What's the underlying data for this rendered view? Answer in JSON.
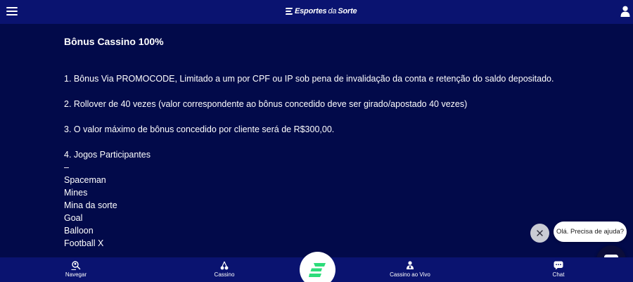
{
  "header": {
    "logo": {
      "text_main": "Esportes",
      "text_da": "da",
      "text_end": "Sorte"
    }
  },
  "content": {
    "title": "Bônus Cassino 100%",
    "rules": [
      "1. Bônus Via PROMOCODE, Limitado a um por CPF ou IP sob pena de invalidação da conta e retenção do saldo depositado.",
      "2. Rollover de 40 vezes (valor correspondente ao bônus concedido deve ser girado/apostado 40 vezes)",
      "3. O valor máximo de bônus concedido por cliente será de R$300,00.",
      "4. Jogos Participantes"
    ],
    "games_separator": "–",
    "games": [
      "Spaceman",
      "Mines",
      "Mina da sorte",
      "Goal",
      "Balloon",
      "Football X"
    ]
  },
  "chat_widget": {
    "bubble_text": "Olá. Precisa de ajuda?"
  },
  "bottom_nav": {
    "items": [
      {
        "label": "Navegar",
        "icon": "search-people-icon"
      },
      {
        "label": "Cassino",
        "icon": "cherries-icon"
      },
      {
        "label": "Cassino ao Vivo",
        "icon": "dealer-icon"
      },
      {
        "label": "Chat",
        "icon": "chat-icon"
      }
    ],
    "center_icon": "brand-e-icon"
  },
  "colors": {
    "background": "#020a4a",
    "bar": "#0a1370",
    "brand_green": "#2ddc7a"
  }
}
